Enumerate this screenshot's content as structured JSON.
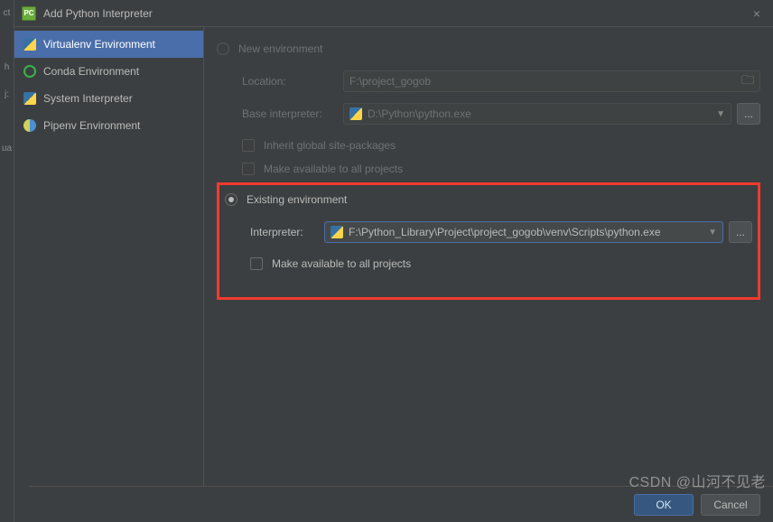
{
  "window": {
    "title": "Add Python Interpreter",
    "close": "×"
  },
  "sidebar": {
    "items": [
      {
        "label": "Virtualenv Environment"
      },
      {
        "label": "Conda Environment"
      },
      {
        "label": "System Interpreter"
      },
      {
        "label": "Pipenv Environment"
      }
    ]
  },
  "new_env": {
    "radio_label": "New environment",
    "location_label": "Location:",
    "location_value": "F:\\project_gogob",
    "base_label": "Base interpreter:",
    "base_value": "D:\\Python\\python.exe",
    "inherit_label": "Inherit global site-packages",
    "avail_label": "Make available to all projects"
  },
  "existing_env": {
    "radio_label": "Existing environment",
    "interp_label": "Interpreter:",
    "interp_value": "F:\\Python_Library\\Project\\project_gogob\\venv\\Scripts\\python.exe",
    "avail_label": "Make available to all projects"
  },
  "buttons": {
    "ok": "OK",
    "cancel": "Cancel",
    "more": "..."
  },
  "watermark": "CSDN @山河不见老"
}
